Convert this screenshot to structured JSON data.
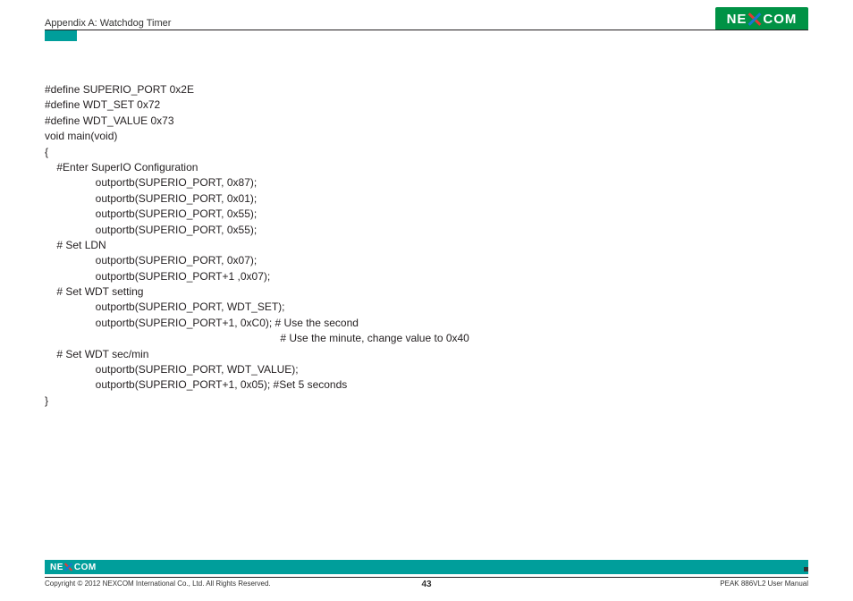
{
  "header": {
    "title": "Appendix A: Watchdog Timer",
    "logo_left": "NE",
    "logo_right": "COM"
  },
  "code": {
    "l01": "#define SUPERIO_PORT 0x2E",
    "l02": "#define WDT_SET 0x72",
    "l03": "#define WDT_VALUE 0x73",
    "l04": "",
    "l05": "void main(void)",
    "l06": "{",
    "l07": "    #Enter SuperIO Configuration",
    "l08": "                 outportb(SUPERIO_PORT, 0x87);",
    "l09": "                 outportb(SUPERIO_PORT, 0x01);",
    "l10": "                 outportb(SUPERIO_PORT, 0x55);",
    "l11": "                 outportb(SUPERIO_PORT, 0x55);",
    "l12": "",
    "l13": "    # Set LDN",
    "l14": "                 outportb(SUPERIO_PORT, 0x07);",
    "l15": "                 outportb(SUPERIO_PORT+1 ,0x07);",
    "l16": "",
    "l17": "    # Set WDT setting",
    "l18": "                 outportb(SUPERIO_PORT, WDT_SET);",
    "l19": "                 outportb(SUPERIO_PORT+1, 0xC0); # Use the second",
    "l20": "                                                                               # Use the minute, change value to 0x40",
    "l21": "    # Set WDT sec/min",
    "l22": "                 outportb(SUPERIO_PORT, WDT_VALUE);",
    "l23": "                 outportb(SUPERIO_PORT+1, 0x05); #Set 5 seconds",
    "l24": "}"
  },
  "footer": {
    "logo_left": "NE",
    "logo_right": "COM",
    "copyright": "Copyright © 2012 NEXCOM International Co., Ltd. All Rights Reserved.",
    "page": "43",
    "manual": "PEAK 886VL2 User Manual"
  }
}
